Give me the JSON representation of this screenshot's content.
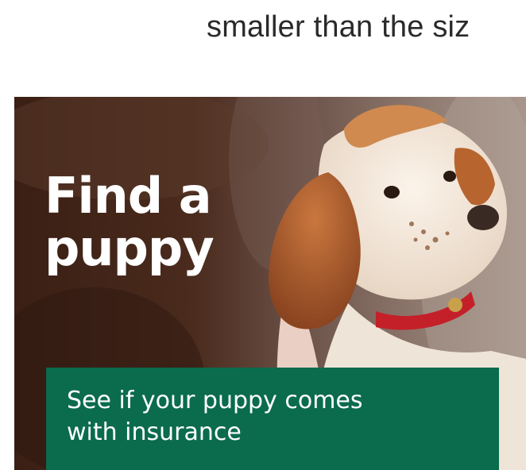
{
  "page": {
    "top_text": "smaller than the siz"
  },
  "ad": {
    "headline_line1": "Find a",
    "headline_line2": "puppy",
    "cta_line1": "See if your puppy comes",
    "cta_line2": "with insurance",
    "image_icon": "puppy-photo",
    "colors": {
      "cta_background": "#0b6b4d",
      "text": "#ffffff",
      "collar": "#c4202a"
    }
  }
}
